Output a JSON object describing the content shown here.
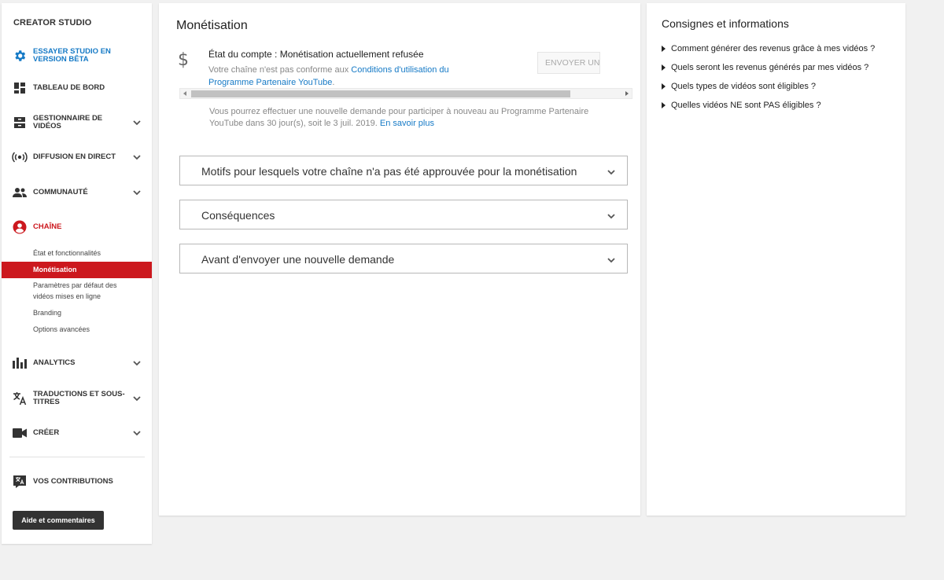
{
  "sidebar": {
    "brand": "CREATOR STUDIO",
    "beta": "ESSAYER STUDIO EN VERSION BÊTA",
    "items": [
      {
        "label": "TABLEAU DE BORD",
        "icon": "dashboard-icon"
      },
      {
        "label": "GESTIONNAIRE DE VIDÉOS",
        "icon": "video-manager-icon"
      },
      {
        "label": "DIFFUSION EN DIRECT",
        "icon": "live-icon"
      },
      {
        "label": "COMMUNAUTÉ",
        "icon": "community-icon"
      },
      {
        "label": "CHAÎNE",
        "icon": "channel-icon"
      },
      {
        "label": "ANALYTICS",
        "icon": "analytics-icon"
      },
      {
        "label": "TRADUCTIONS ET SOUS-TITRES",
        "icon": "translate-icon"
      },
      {
        "label": "CRÉER",
        "icon": "create-icon"
      }
    ],
    "channel_sub": [
      "État et fonctionnalités",
      "Monétisation",
      "Paramètres par défaut des vidéos mises en ligne",
      "Branding",
      "Options avancées"
    ],
    "contributions": "VOS CONTRIBUTIONS",
    "help_button": "Aide et commentaires"
  },
  "main": {
    "title": "Monétisation",
    "status": "État du compte : Monétisation actuellement refusée",
    "desc_prefix": "Votre chaîne n'est pas conforme aux ",
    "desc_link": "Conditions d'utilisation du Programme Partenaire YouTube",
    "desc_suffix": ".",
    "resubmit_button": "ENVOYER UNE NOUVE",
    "note": "Vous pourrez effectuer une nouvelle demande pour participer à nouveau au Programme Partenaire YouTube dans 30 jour(s), soit le 3 juil. 2019. ",
    "note_link": "En savoir plus",
    "accordions": [
      "Motifs pour lesquels votre chaîne n'a pas été approuvée pour la monétisation",
      "Conséquences",
      "Avant d'envoyer une nouvelle demande"
    ]
  },
  "right": {
    "title": "Consignes et informations",
    "faqs": [
      "Comment générer des revenus grâce à mes vidéos ?",
      "Quels seront les revenus générés par mes vidéos ?",
      "Quels types de vidéos sont éligibles ?",
      "Quelles vidéos NE sont PAS éligibles ?"
    ]
  },
  "colors": {
    "accent_red": "#cc181e",
    "link_blue": "#167ac6"
  }
}
